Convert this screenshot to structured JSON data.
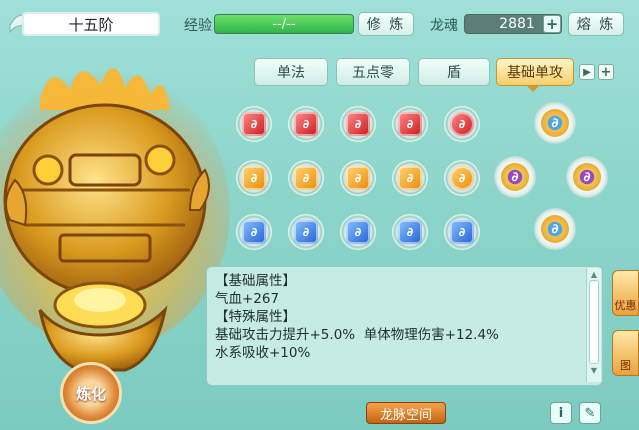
{
  "header": {
    "rank": "十五阶",
    "exp_label": "经验",
    "exp_value": "--/--",
    "cultivate_btn": "修 炼",
    "soul_label": "龙魂",
    "soul_value": "2881",
    "plus": "+",
    "smelt_btn": "熔 炼"
  },
  "tabs": [
    "单法",
    "五点零",
    "盾",
    "基础单攻"
  ],
  "tab_active_index": 3,
  "gem_rows": [
    {
      "color": "red",
      "count": 5
    },
    {
      "color": "orange",
      "count": 5
    },
    {
      "color": "blue",
      "count": 5
    }
  ],
  "gem_glyph": "∂",
  "slots": [
    {
      "pos": "top",
      "color": "gold"
    },
    {
      "pos": "left",
      "color": "purple"
    },
    {
      "pos": "right",
      "color": "purple"
    },
    {
      "pos": "bottom",
      "color": "gold"
    }
  ],
  "info": {
    "base_title": "【基础属性】",
    "base_line": "气血+267",
    "special_title": "【特殊属性】",
    "special_line1": "基础攻击力提升+5.0%  单体物理伤害+12.4%",
    "special_line2": "水系吸收+10%"
  },
  "bottom": {
    "space_btn": "龙脉空间",
    "info_btn": "i",
    "edit_btn": "✎",
    "refine_btn": "炼化"
  },
  "side": {
    "item1": "优惠",
    "item2": "图"
  },
  "colors": {
    "bg": "#8ed6cc",
    "exp_bar": "#2fb44a",
    "active_tab": "#f6cf6a",
    "space_btn": "#c46412"
  }
}
